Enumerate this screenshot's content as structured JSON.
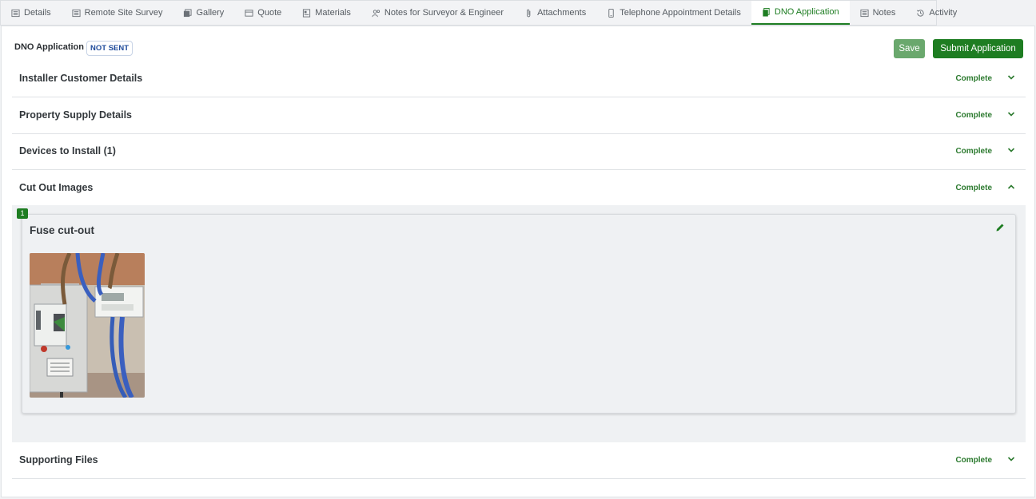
{
  "tabs": [
    {
      "label": "Details",
      "icon": "list-icon",
      "active": false
    },
    {
      "label": "Remote Site Survey",
      "icon": "list-icon",
      "active": false
    },
    {
      "label": "Gallery",
      "icon": "gallery-icon",
      "active": false
    },
    {
      "label": "Quote",
      "icon": "card-icon",
      "active": false
    },
    {
      "label": "Materials",
      "icon": "materials-icon",
      "active": false
    },
    {
      "label": "Notes for Surveyor & Engineer",
      "icon": "users-icon",
      "active": false
    },
    {
      "label": "Attachments",
      "icon": "paperclip-icon",
      "active": false
    },
    {
      "label": "Telephone Appointment Details",
      "icon": "phone-icon",
      "active": false
    },
    {
      "label": "DNO Application",
      "icon": "document-icon",
      "active": true
    },
    {
      "label": "Notes",
      "icon": "list-icon",
      "active": false
    },
    {
      "label": "Activity",
      "icon": "history-icon",
      "active": false
    }
  ],
  "header": {
    "title": "DNO Application",
    "status_badge": "NOT SENT",
    "save_label": "Save",
    "submit_label": "Submit Application"
  },
  "sections": [
    {
      "title": "Installer Customer Details",
      "status": "Complete",
      "expanded": false
    },
    {
      "title": "Property Supply Details",
      "status": "Complete",
      "expanded": false
    },
    {
      "title": "Devices to Install (1)",
      "status": "Complete",
      "expanded": false
    },
    {
      "title": "Cut Out Images",
      "status": "Complete",
      "expanded": true
    },
    {
      "title": "Supporting Files",
      "status": "Complete",
      "expanded": false
    }
  ],
  "cut_out": {
    "card_number": "1",
    "card_title": "Fuse cut-out",
    "image_subject": "electricity meter and fuse cut-out photo"
  },
  "colors": {
    "accent": "#1e7d22",
    "save_button": "#6aa86d",
    "badge_text": "#1f4b9b"
  }
}
